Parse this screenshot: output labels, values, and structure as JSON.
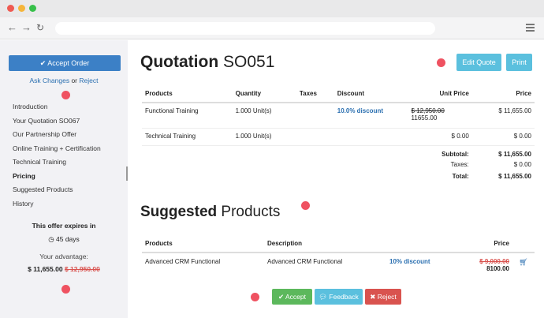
{
  "colors": {
    "primary": "#3c80c6",
    "info": "#5bc0de",
    "success": "#5cb85c",
    "danger": "#d9534f",
    "marker": "#ef5261"
  },
  "sidebar": {
    "accept_order": "Accept Order",
    "ask_changes": "Ask Changes",
    "or": "or",
    "reject": "Reject",
    "nav": [
      "Introduction",
      "Your Quotation SO067",
      "Our Partnership Offer",
      "Online Training + Certification",
      "Technical Training",
      "Pricing",
      "Suggested Products",
      "History"
    ],
    "active_nav": "Pricing",
    "expires_label": "This offer expires in",
    "days": "45 days",
    "advantage_label": "Your advantage:",
    "advantage_price": "$ 11,655.00",
    "advantage_old_price": "$ 12,950.00"
  },
  "header": {
    "title_bold": "Quotation",
    "title_rest": "SO051",
    "edit_quote": "Edit Quote",
    "print": "Print"
  },
  "quotation": {
    "columns": [
      "Products",
      "Quantity",
      "Taxes",
      "Discount",
      "Unit Price",
      "Price"
    ],
    "rows": [
      {
        "product": "Functional Training",
        "quantity": "1.000 Unit(s)",
        "taxes": "",
        "discount": "10.0% discount",
        "unit_old": "$ 12,950.00",
        "unit_price": "11655.00",
        "price": "$ 11,655.00"
      },
      {
        "product": "Technical Training",
        "quantity": "1.000 Unit(s)",
        "taxes": "",
        "discount": "",
        "unit_old": "",
        "unit_price": "$ 0.00",
        "price": "$ 0.00"
      }
    ],
    "subtotal_label": "Subtotal:",
    "subtotal": "$ 11,655.00",
    "taxes_label": "Taxes:",
    "taxes": "$ 0.00",
    "total_label": "Total:",
    "total": "$ 11,655.00"
  },
  "suggested": {
    "title_bold": "Suggested",
    "title_rest": "Products",
    "columns": [
      "Products",
      "Description",
      "",
      "Price"
    ],
    "rows": [
      {
        "product": "Advanced CRM Functional",
        "description": "Advanced CRM Functional",
        "discount": "10% discount",
        "price_old": "$ 9,000.00",
        "price": "8100.00",
        "icon": "cart-icon"
      }
    ]
  },
  "footer": {
    "accept": "Accept",
    "feedback": "Feedback",
    "reject": "Reject"
  }
}
